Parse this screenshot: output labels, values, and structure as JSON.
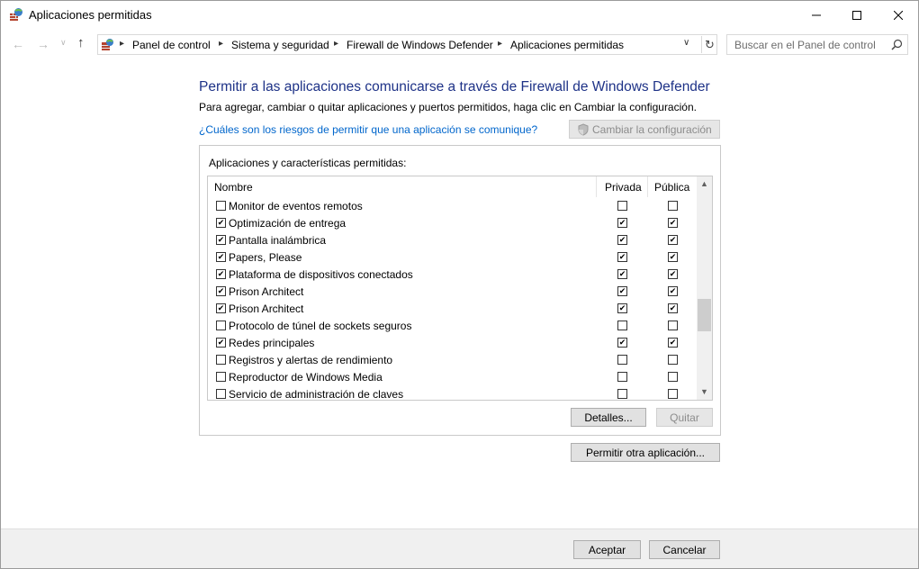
{
  "window": {
    "title": "Aplicaciones permitidas",
    "minimize_icon": "minimize-icon",
    "maximize_icon": "maximize-icon",
    "close_icon": "close-icon"
  },
  "nav": {
    "breadcrumbs": [
      "Panel de control",
      "Sistema y seguridad",
      "Firewall de Windows Defender",
      "Aplicaciones permitidas"
    ],
    "search_placeholder": "Buscar en el Panel de control"
  },
  "main": {
    "heading": "Permitir a las aplicaciones comunicarse a través de Firewall de Windows Defender",
    "description": "Para agregar, cambiar o quitar aplicaciones y puertos permitidos, haga clic en Cambiar la configuración.",
    "risk_link": "¿Cuáles son los riesgos de permitir que una aplicación se comunique?",
    "change_settings_label": "Cambiar la configuración",
    "group_label": "Aplicaciones y características permitidas:",
    "columns": {
      "name": "Nombre",
      "private": "Privada",
      "public": "Pública"
    },
    "apps": [
      {
        "name": "Monitor de eventos remotos",
        "enabled": false,
        "private": false,
        "public": false
      },
      {
        "name": "Optimización de entrega",
        "enabled": true,
        "private": true,
        "public": true
      },
      {
        "name": "Pantalla inalámbrica",
        "enabled": true,
        "private": true,
        "public": true
      },
      {
        "name": "Papers, Please",
        "enabled": true,
        "private": true,
        "public": true
      },
      {
        "name": "Plataforma de dispositivos conectados",
        "enabled": true,
        "private": true,
        "public": true
      },
      {
        "name": "Prison Architect",
        "enabled": true,
        "private": true,
        "public": true
      },
      {
        "name": "Prison Architect",
        "enabled": true,
        "private": true,
        "public": true
      },
      {
        "name": "Protocolo de túnel de sockets seguros",
        "enabled": false,
        "private": false,
        "public": false
      },
      {
        "name": "Redes principales",
        "enabled": true,
        "private": true,
        "public": true
      },
      {
        "name": "Registros y alertas de rendimiento",
        "enabled": false,
        "private": false,
        "public": false
      },
      {
        "name": "Reproductor de Windows Media",
        "enabled": false,
        "private": false,
        "public": false
      },
      {
        "name": "Servicio de administración de claves",
        "enabled": false,
        "private": false,
        "public": false
      }
    ],
    "details_label": "Detalles...",
    "remove_label": "Quitar",
    "allow_other_label": "Permitir otra aplicación..."
  },
  "footer": {
    "ok_label": "Aceptar",
    "cancel_label": "Cancelar"
  },
  "colors": {
    "heading": "#1e3287",
    "link": "#0066cc",
    "footer_bg": "#f0f0f0"
  }
}
